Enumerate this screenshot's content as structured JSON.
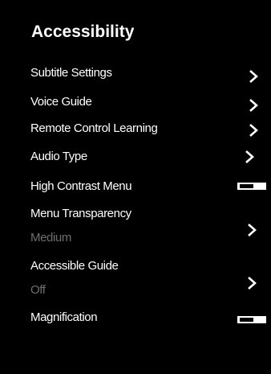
{
  "menu": {
    "title": "Accessibility",
    "items": [
      {
        "label": "Subtitle Settings",
        "control": "chevron"
      },
      {
        "label": "Voice Guide",
        "control": "chevron"
      },
      {
        "label": "Remote Control Learning",
        "control": "chevron"
      },
      {
        "label": "Audio Type",
        "control": "chevron"
      },
      {
        "label": "High Contrast Menu",
        "control": "toggle",
        "state": "off"
      },
      {
        "label": "Menu Transparency",
        "value": "Medium",
        "control": "chevron"
      },
      {
        "label": "Accessible Guide",
        "value": "Off",
        "control": "chevron"
      },
      {
        "label": "Magnification",
        "control": "toggle",
        "state": "off"
      }
    ]
  },
  "colors": {
    "background": "#000000",
    "text": "#ffffff",
    "secondary_text": "#6e6e6e"
  },
  "icons": {
    "chevron": "chevron-right-icon",
    "toggle": "toggle-switch"
  }
}
